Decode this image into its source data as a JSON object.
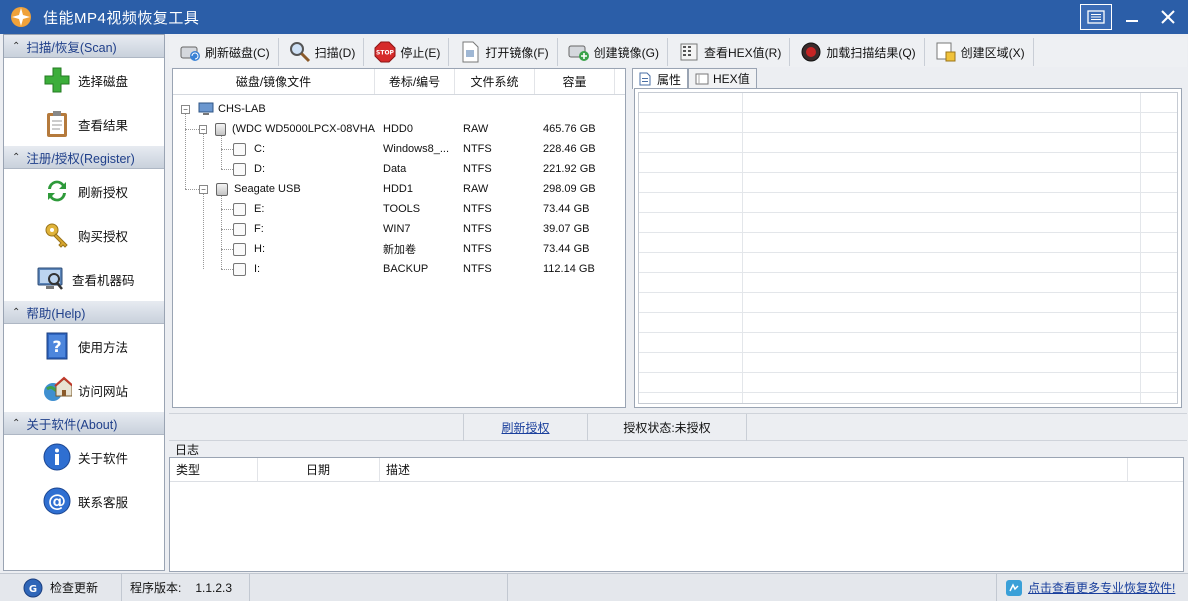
{
  "window": {
    "title": "佳能MP4视频恢复工具"
  },
  "sidebar": {
    "sections": [
      {
        "header": "扫描/恢复(Scan)",
        "items": [
          {
            "label": "选择磁盘",
            "icon": "plus-icon"
          },
          {
            "label": "查看结果",
            "icon": "clipboard-icon"
          }
        ]
      },
      {
        "header": "注册/授权(Register)",
        "items": [
          {
            "label": "刷新授权",
            "icon": "refresh-icon"
          },
          {
            "label": "购买授权",
            "icon": "key-icon"
          },
          {
            "label": "查看机器码",
            "icon": "computer-icon"
          }
        ]
      },
      {
        "header": "帮助(Help)",
        "items": [
          {
            "label": "使用方法",
            "icon": "help-book-icon"
          },
          {
            "label": "访问网站",
            "icon": "globe-home-icon"
          }
        ]
      },
      {
        "header": "关于软件(About)",
        "items": [
          {
            "label": "关于软件",
            "icon": "info-icon"
          },
          {
            "label": "联系客服",
            "icon": "at-icon"
          }
        ]
      }
    ]
  },
  "toolbar": {
    "refresh": "刷新磁盘(C)",
    "scan": "扫描(D)",
    "stop": "停止(E)",
    "open_image": "打开镜像(F)",
    "create_image": "创建镜像(G)",
    "hex": "查看HEX值(R)",
    "load_results": "加载扫描结果(Q)",
    "create_region": "创建区域(X)"
  },
  "tree": {
    "columns": [
      "磁盘/镜像文件",
      "卷标/编号",
      "文件系统",
      "容量"
    ],
    "rows": [
      {
        "name": "CHS-LAB",
        "label": "",
        "fs": "",
        "size": ""
      },
      {
        "name": "(WDC WD5000LPCX-08VHA",
        "label": "HDD0",
        "fs": "RAW",
        "size": "465.76 GB"
      },
      {
        "name": "C:",
        "label": "Windows8_...",
        "fs": "NTFS",
        "size": "228.46 GB"
      },
      {
        "name": "D:",
        "label": "Data",
        "fs": "NTFS",
        "size": "221.92 GB"
      },
      {
        "name": "Seagate USB",
        "label": "HDD1",
        "fs": "RAW",
        "size": "298.09 GB"
      },
      {
        "name": "E:",
        "label": "TOOLS",
        "fs": "NTFS",
        "size": "73.44 GB"
      },
      {
        "name": "F:",
        "label": "WIN7",
        "fs": "NTFS",
        "size": "39.07 GB"
      },
      {
        "name": "H:",
        "label": "新加卷",
        "fs": "NTFS",
        "size": "73.44 GB"
      },
      {
        "name": "I:",
        "label": "BACKUP",
        "fs": "NTFS",
        "size": "112.14 GB"
      }
    ]
  },
  "props": {
    "tab_properties": "属性",
    "tab_hex": "HEX值"
  },
  "midbar": {
    "refresh_link": "刷新授权",
    "status": "授权状态:未授权"
  },
  "log": {
    "label": "日志",
    "columns": [
      "类型",
      "日期",
      "描述"
    ]
  },
  "statusbar": {
    "update": "检查更新",
    "version_label": "程序版本:",
    "version": "1.1.2.3",
    "more_link": "点击查看更多专业恢复软件!"
  }
}
